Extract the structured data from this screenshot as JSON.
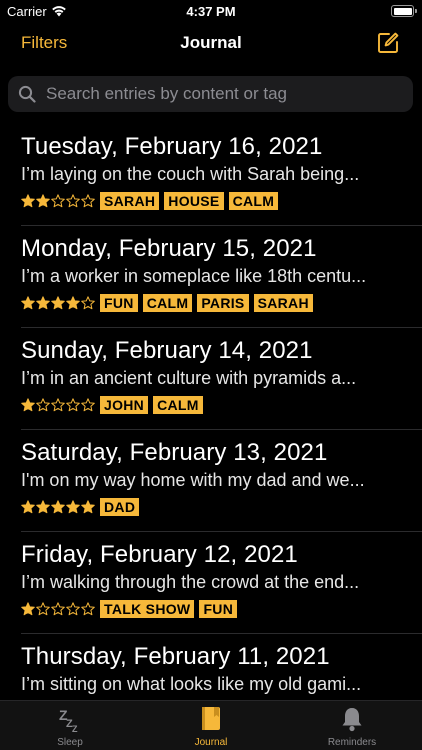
{
  "status_bar": {
    "carrier": "Carrier",
    "time": "4:37 PM"
  },
  "nav": {
    "left_label": "Filters",
    "title": "Journal",
    "compose_icon": "compose-icon"
  },
  "search": {
    "placeholder": "Search entries by content or tag",
    "value": ""
  },
  "colors": {
    "accent": "#f6b83a",
    "background": "#000000",
    "search_bg": "#1c1c1e",
    "tab_bar_bg": "#121212"
  },
  "entries": [
    {
      "date": "Tuesday, February 16, 2021",
      "preview": "I’m laying on the couch with Sarah being...",
      "rating": 2,
      "max_rating": 5,
      "tags": [
        "SARAH",
        "HOUSE",
        "CALM"
      ]
    },
    {
      "date": "Monday, February 15, 2021",
      "preview": "I’m a worker in someplace like 18th centu...",
      "rating": 4,
      "max_rating": 5,
      "tags": [
        "FUN",
        "CALM",
        "PARIS",
        "SARAH"
      ]
    },
    {
      "date": "Sunday, February 14, 2021",
      "preview": "I’m in an ancient culture with pyramids a...",
      "rating": 1,
      "max_rating": 5,
      "tags": [
        "JOHN",
        "CALM"
      ]
    },
    {
      "date": "Saturday, February 13, 2021",
      "preview": "I'm on my way home with my dad and we...",
      "rating": 5,
      "max_rating": 5,
      "tags": [
        "DAD"
      ]
    },
    {
      "date": "Friday, February 12, 2021",
      "preview": "I’m walking through the crowd at the end...",
      "rating": 1,
      "max_rating": 5,
      "tags": [
        "TALK SHOW",
        "FUN"
      ]
    },
    {
      "date": "Thursday, February 11, 2021",
      "preview": "I’m sitting on what looks like my old gami...",
      "rating": 0,
      "max_rating": 5,
      "tags": []
    }
  ],
  "tabs": [
    {
      "label": "Sleep",
      "icon": "sleep-icon",
      "active": false
    },
    {
      "label": "Journal",
      "icon": "journal-book-icon",
      "active": true
    },
    {
      "label": "Reminders",
      "icon": "bell-icon",
      "active": false
    }
  ]
}
